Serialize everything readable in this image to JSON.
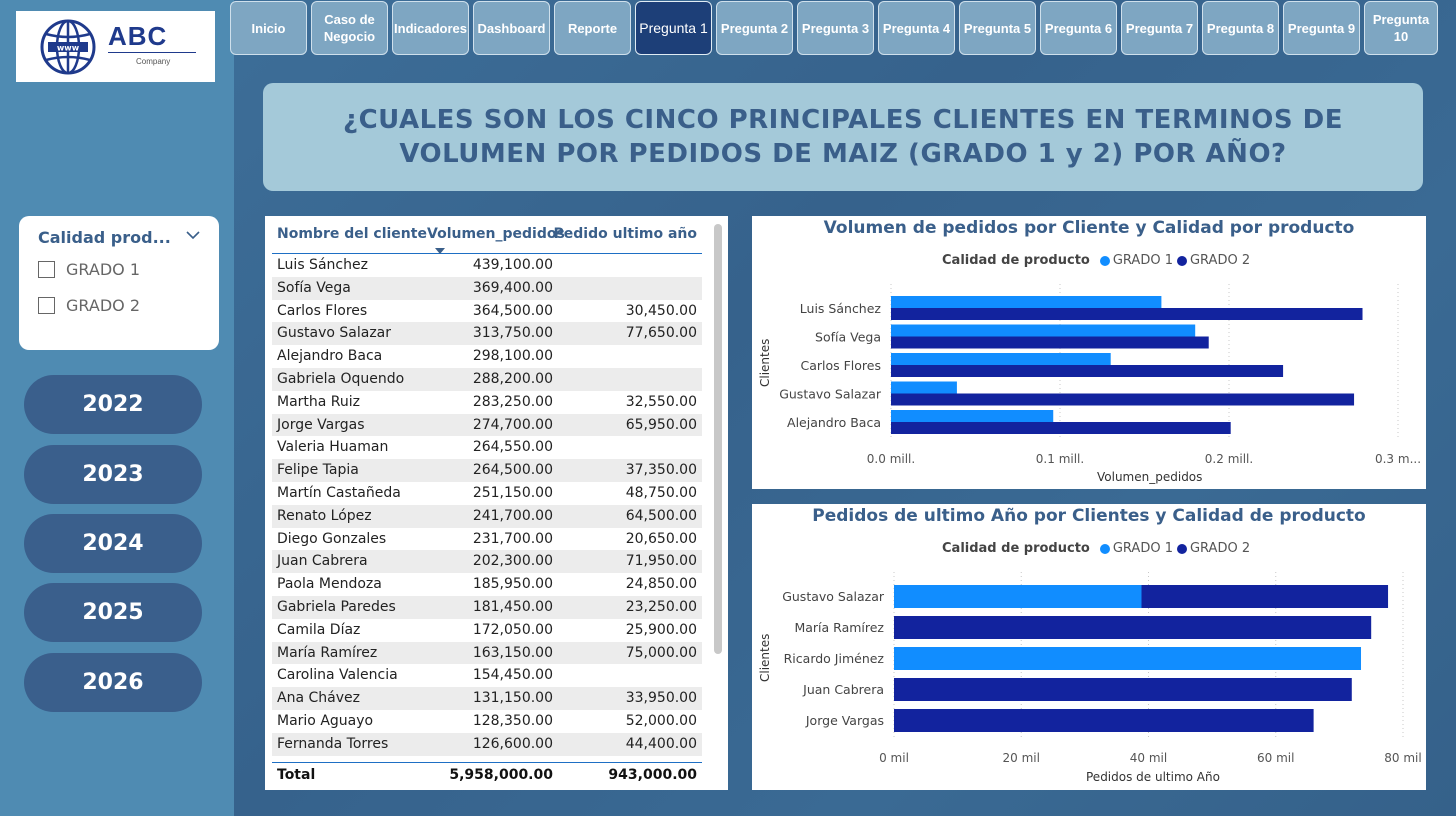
{
  "logo": {
    "brand": "ABC",
    "sub": "Company",
    "globe_text": "www"
  },
  "nav": {
    "items": [
      {
        "label": "Inicio",
        "active": false
      },
      {
        "label": "Caso de Negocio",
        "active": false
      },
      {
        "label": "Indicadores",
        "active": false
      },
      {
        "label": "Dashboard",
        "active": false
      },
      {
        "label": "Reporte",
        "active": false
      },
      {
        "label": "Pregunta 1",
        "active": true
      },
      {
        "label": "Pregunta 2",
        "active": false
      },
      {
        "label": "Pregunta 3",
        "active": false
      },
      {
        "label": "Pregunta 4",
        "active": false
      },
      {
        "label": "Pregunta 5",
        "active": false
      },
      {
        "label": "Pregunta 6",
        "active": false
      },
      {
        "label": "Pregunta 7",
        "active": false
      },
      {
        "label": "Pregunta 8",
        "active": false
      },
      {
        "label": "Pregunta 9",
        "active": false
      },
      {
        "label": "Pregunta 10",
        "active": false
      }
    ]
  },
  "title": {
    "line1": "¿CUALES SON LOS CINCO PRINCIPALES CLIENTES EN TERMINOS DE",
    "line2": "VOLUMEN POR PEDIDOS DE MAIZ (GRADO 1 y 2) POR AÑO?"
  },
  "filter": {
    "title": "Calidad prod...",
    "options": [
      "GRADO 1",
      "GRADO 2"
    ]
  },
  "years": [
    "2022",
    "2023",
    "2024",
    "2025",
    "2026"
  ],
  "table": {
    "headers": [
      "Nombre del cliente",
      "Volumen_pedidos",
      "Pedido ultimo año"
    ],
    "rows": [
      [
        "Luis Sánchez",
        "439,100.00",
        ""
      ],
      [
        "Sofía Vega",
        "369,400.00",
        ""
      ],
      [
        "Carlos Flores",
        "364,500.00",
        "30,450.00"
      ],
      [
        "Gustavo Salazar",
        "313,750.00",
        "77,650.00"
      ],
      [
        "Alejandro Baca",
        "298,100.00",
        ""
      ],
      [
        "Gabriela Oquendo",
        "288,200.00",
        ""
      ],
      [
        "Martha Ruiz",
        "283,250.00",
        "32,550.00"
      ],
      [
        "Jorge Vargas",
        "274,700.00",
        "65,950.00"
      ],
      [
        "Valeria Huaman",
        "264,550.00",
        ""
      ],
      [
        "Felipe Tapia",
        "264,500.00",
        "37,350.00"
      ],
      [
        "Martín Castañeda",
        "251,150.00",
        "48,750.00"
      ],
      [
        "Renato López",
        "241,700.00",
        "64,500.00"
      ],
      [
        "Diego Gonzales",
        "231,700.00",
        "20,650.00"
      ],
      [
        "Juan Cabrera",
        "202,300.00",
        "71,950.00"
      ],
      [
        "Paola Mendoza",
        "185,950.00",
        "24,850.00"
      ],
      [
        "Gabriela Paredes",
        "181,450.00",
        "23,250.00"
      ],
      [
        "Camila Díaz",
        "172,050.00",
        "25,900.00"
      ],
      [
        "María Ramírez",
        "163,150.00",
        "75,000.00"
      ],
      [
        "Carolina Valencia",
        "154,450.00",
        ""
      ],
      [
        "Ana Chávez",
        "131,150.00",
        "33,950.00"
      ],
      [
        "Mario Aguayo",
        "128,350.00",
        "52,000.00"
      ],
      [
        "Fernanda Torres",
        "126,600.00",
        "44,400.00"
      ]
    ],
    "total": [
      "Total",
      "5,958,000.00",
      "943,000.00"
    ]
  },
  "colors": {
    "grado1": "#118dff",
    "grado2": "#12239e"
  },
  "chart_data": [
    {
      "type": "bar",
      "orientation": "horizontal",
      "title": "Volumen de pedidos por Cliente y Calidad por producto",
      "legend_title": "Calidad de producto",
      "xlabel": "Volumen_pedidos",
      "ylabel": "Clientes",
      "categories": [
        "Luis Sánchez",
        "Sofía Vega",
        "Carlos Flores",
        "Gustavo Salazar",
        "Alejandro Baca"
      ],
      "series": [
        {
          "name": "GRADO 1",
          "values": [
            0.16,
            0.18,
            0.13,
            0.039,
            0.096
          ]
        },
        {
          "name": "GRADO 2",
          "values": [
            0.279,
            0.188,
            0.232,
            0.274,
            0.201
          ]
        }
      ],
      "xlim": [
        0,
        0.3
      ],
      "xticks": [
        "0.0 mill.",
        "0.1 mill.",
        "0.2 mill.",
        "0.3 m..."
      ],
      "grid": true
    },
    {
      "type": "bar",
      "orientation": "horizontal",
      "stacked": true,
      "title": "Pedidos de ultimo Año por Clientes y Calidad de producto",
      "legend_title": "Calidad de producto",
      "xlabel": "Pedidos de ultimo Año",
      "ylabel": "Clientes",
      "categories": [
        "Gustavo Salazar",
        "María Ramírez",
        "Ricardo Jiménez",
        "Juan Cabrera",
        "Jorge Vargas"
      ],
      "series": [
        {
          "name": "GRADO 1",
          "values": [
            38.9,
            0,
            73.4,
            0,
            0
          ]
        },
        {
          "name": "GRADO 2",
          "values": [
            38.75,
            75.0,
            0,
            71.95,
            65.95
          ]
        }
      ],
      "xlim": [
        0,
        80
      ],
      "xticks": [
        "0 mil",
        "20 mil",
        "40 mil",
        "60 mil",
        "80 mil"
      ],
      "grid": true
    }
  ]
}
